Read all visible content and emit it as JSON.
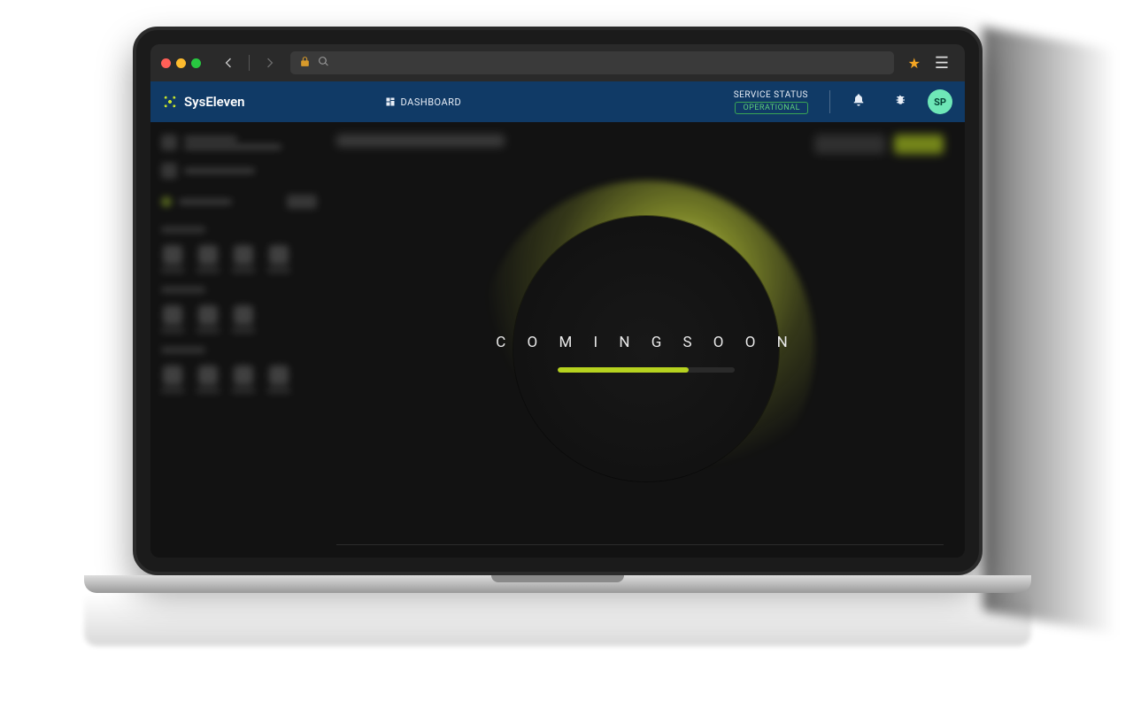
{
  "browser": {
    "secure_icon": "lock",
    "search_icon": "search",
    "url_value": "",
    "star_active": true
  },
  "header": {
    "brand": "SysEleven",
    "dashboard_label": "DASHBOARD",
    "service_status_label": "SERVICE STATUS",
    "service_status_value": "OPERATIONAL",
    "avatar_initials": "SP"
  },
  "overlay": {
    "coming_soon": "C O M I N G   S O O N",
    "progress_percent": 74
  },
  "colors": {
    "header_bg": "#103a66",
    "accent_green": "#b6d21f",
    "avatar_bg": "#6ee7b7",
    "status_border": "#3aa655"
  }
}
